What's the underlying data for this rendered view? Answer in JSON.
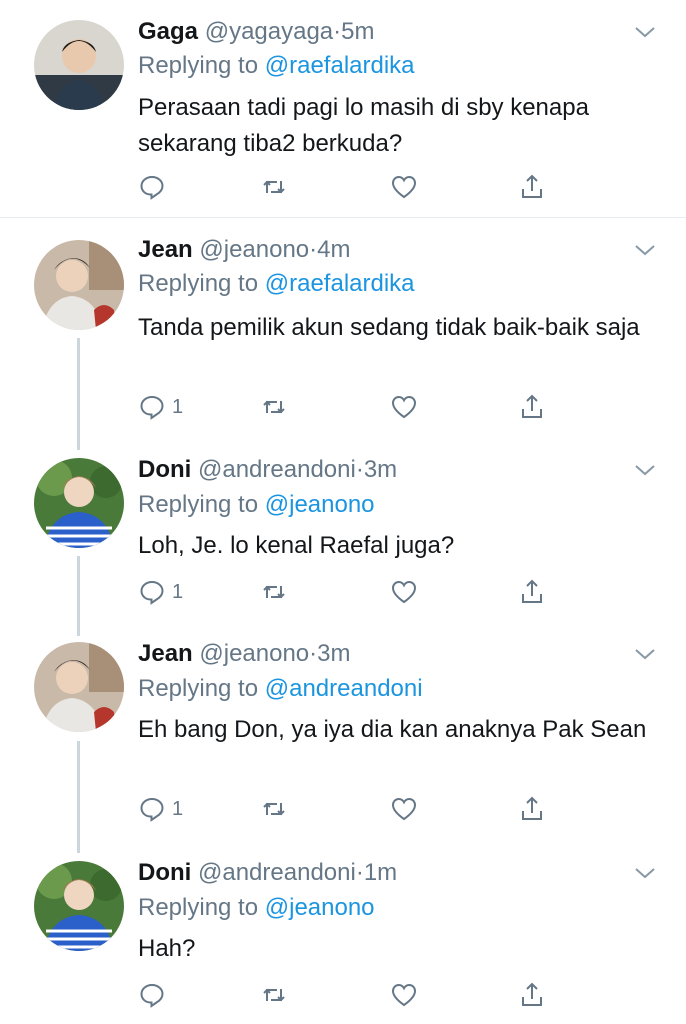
{
  "replying_prefix": "Replying to",
  "tweets": [
    {
      "name": "Gaga",
      "handle": "@yagayaga",
      "dot": "·",
      "time": "5m",
      "reply_to": "@raefalardika",
      "text": "Perasaan tadi pagi lo masih di sby kenapa sekarang tiba2 berkuda?",
      "reply_count": "",
      "avatar": "avatar-gaga"
    },
    {
      "name": "Jean",
      "handle": "@jeanono",
      "dot": "·",
      "time": "4m",
      "reply_to": "@raefalardika",
      "text": "Tanda pemilik akun sedang tidak baik-baik saja",
      "reply_count": "1",
      "avatar": "avatar-jean"
    },
    {
      "name": "Doni",
      "handle": "@andreandoni",
      "dot": "·",
      "time": "3m",
      "reply_to": "@jeanono",
      "text": "Loh, Je. lo kenal Raefal juga?",
      "reply_count": "1",
      "avatar": "avatar-doni"
    },
    {
      "name": "Jean",
      "handle": "@jeanono",
      "dot": "·",
      "time": "3m",
      "reply_to": "@andreandoni",
      "text": "Eh bang Don, ya iya dia kan anaknya Pak Sean",
      "reply_count": "1",
      "avatar": "avatar-jean"
    },
    {
      "name": "Doni",
      "handle": "@andreandoni",
      "dot": "·",
      "time": "1m",
      "reply_to": "@jeanono",
      "text": "Hah?",
      "reply_count": "",
      "avatar": "avatar-doni"
    }
  ],
  "colors": {
    "link": "#1b95e0",
    "muted": "#657786",
    "text": "#14171a",
    "line": "#ccd6dd"
  },
  "icons": [
    "reply-icon",
    "retweet-icon",
    "like-icon",
    "share-icon",
    "chevron-down-icon"
  ]
}
